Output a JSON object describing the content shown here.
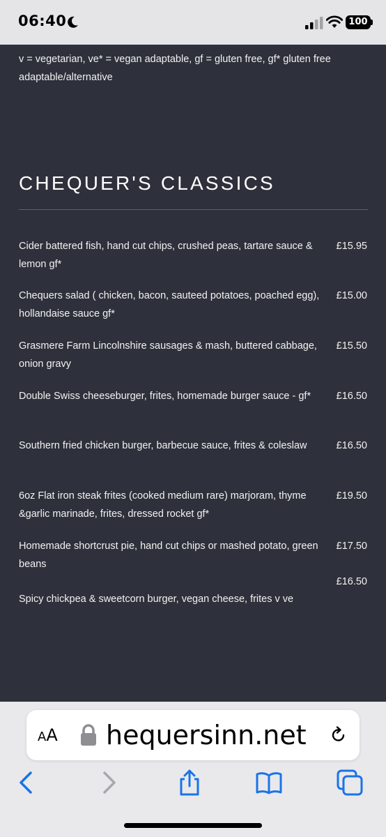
{
  "status_bar": {
    "time": "06:40",
    "battery": "100"
  },
  "legend": "v =  vegetarian, ve* = vegan adaptable, gf = gluten free, gf* gluten free adaptable/alternative",
  "section_title": "CHEQUER'S CLASSICS",
  "menu_items": [
    {
      "desc": "Cider battered fish, hand cut chips, crushed peas, tartare sauce & lemon gf*",
      "price": "£15.95"
    },
    {
      "desc": "Chequers salad ( chicken, bacon, sauteed potatoes, poached egg), hollandaise sauce gf*",
      "price": "£15.00"
    },
    {
      "desc": "Grasmere Farm Lincolnshire sausages & mash, buttered cabbage, onion gravy",
      "price": "£15.50"
    },
    {
      "desc": "Double Swiss cheeseburger, frites, homemade burger sauce - gf*",
      "price": "£16.50"
    },
    {
      "desc": "Southern fried chicken burger, barbecue sauce, frites & coleslaw",
      "price": "£16.50"
    },
    {
      "desc": "6oz Flat iron steak frites (cooked medium rare) marjoram, thyme &garlic marinade, frites, dressed rocket gf*",
      "price": "£19.50"
    },
    {
      "desc": "Homemade shortcrust pie, hand cut chips or mashed potato, green beans",
      "price": "£17.50"
    },
    {
      "desc": "Spicy chickpea & sweetcorn burger, vegan cheese, frites v ve",
      "price": "£16.50"
    }
  ],
  "browser": {
    "aa_large": "A",
    "aa_small": "A",
    "url": "hequersinn.net",
    "accent_color": "#1a73e8"
  },
  "icons": {
    "moon": "moon-icon",
    "signal": "cellular-signal-icon",
    "wifi": "wifi-icon",
    "lock": "lock-icon",
    "reload": "reload-icon",
    "back": "back-chevron-icon",
    "forward": "forward-chevron-icon",
    "share": "share-icon",
    "bookmarks": "bookmarks-icon",
    "tabs": "tabs-icon"
  }
}
